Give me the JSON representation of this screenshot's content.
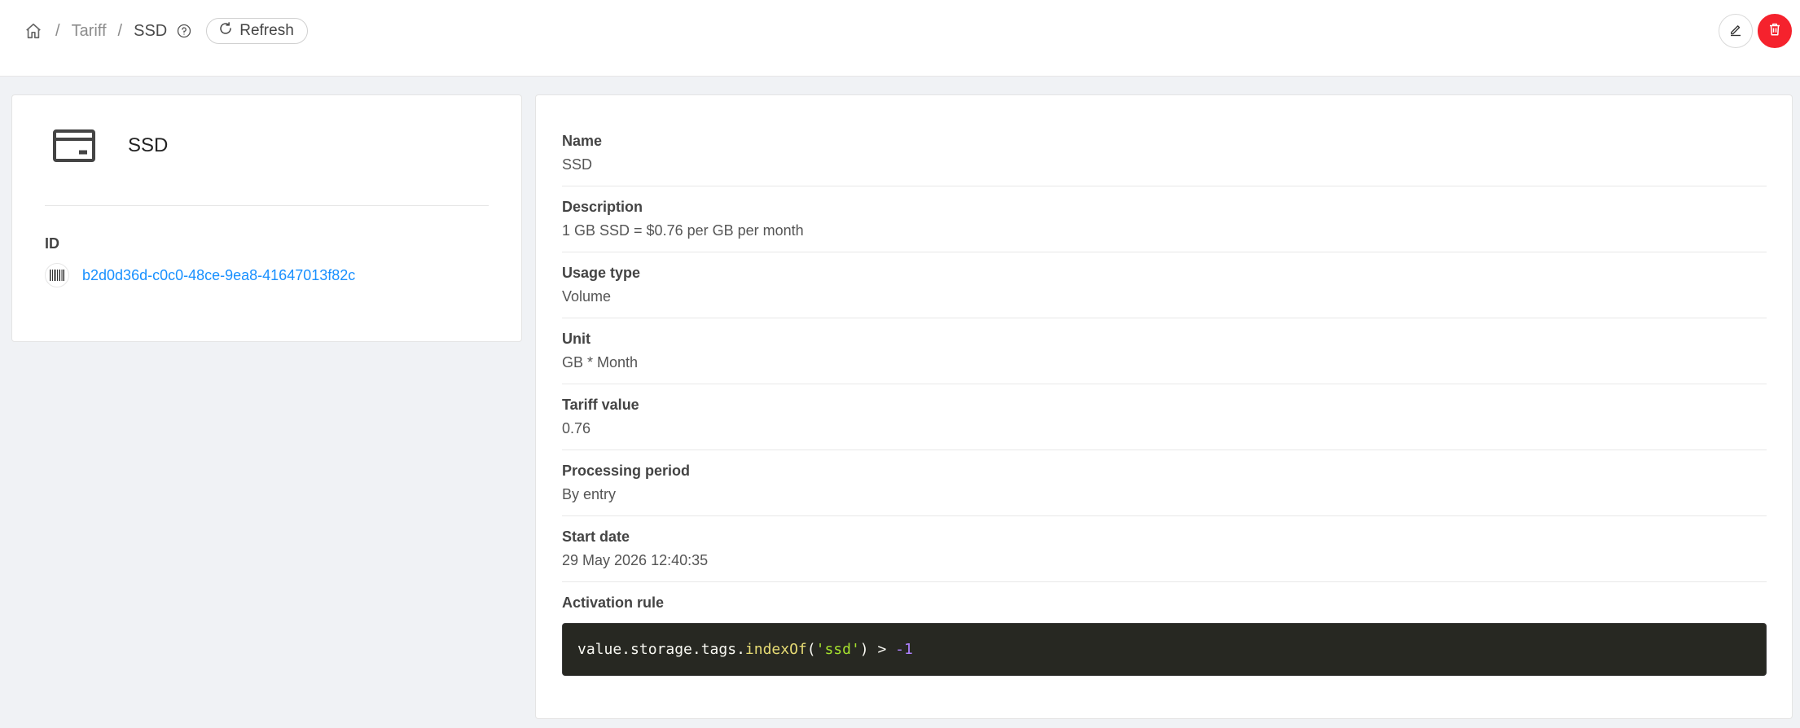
{
  "breadcrumb": {
    "items": [
      {
        "label": "Tariff"
      },
      {
        "label": "SSD"
      }
    ],
    "separator": "/"
  },
  "toolbar": {
    "refresh_label": "Refresh"
  },
  "summary": {
    "title": "SSD",
    "id_label": "ID",
    "id_value": "b2d0d36d-c0c0-48ce-9ea8-41647013f82c"
  },
  "details": {
    "fields": [
      {
        "label": "Name",
        "value": "SSD"
      },
      {
        "label": "Description",
        "value": "1 GB SSD = $0.76 per GB per month"
      },
      {
        "label": "Usage type",
        "value": "Volume"
      },
      {
        "label": "Unit",
        "value": "GB * Month"
      },
      {
        "label": "Tariff value",
        "value": "0.76"
      },
      {
        "label": "Processing period",
        "value": "By entry"
      },
      {
        "label": "Start date",
        "value": "29 May 2026 12:40:35"
      }
    ],
    "activation_rule_label": "Activation rule",
    "activation_rule": {
      "p1": "value.storage.tags.",
      "fn": "indexOf",
      "p2": "(",
      "str": "'ssd'",
      "p3": ") > ",
      "num": "-1"
    }
  },
  "colors": {
    "link": "#1890ff",
    "danger": "#f5222d",
    "code_bg": "#272822"
  },
  "icons": {
    "home": "home-icon",
    "help": "question-circle-icon",
    "refresh": "reload-icon",
    "edit": "pencil-icon",
    "delete": "trash-icon",
    "tariff": "credit-card-icon",
    "id": "barcode-icon"
  }
}
